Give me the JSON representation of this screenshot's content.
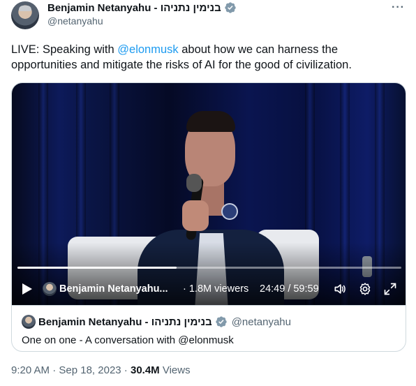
{
  "author": {
    "display_name": "Benjamin Netanyahu - בנימין נתניהו",
    "handle": "@netanyahu",
    "verified_color": "#829aab"
  },
  "tweet": {
    "text_before": "LIVE: Speaking with ",
    "mention": "@elonmusk",
    "text_after": " about how we can harness the opportunities and mitigate the risks of AI for the good of civilization."
  },
  "video": {
    "live_name": "Benjamin Netanyahu...",
    "viewers_prefix": "· ",
    "viewers": "1.8M viewers",
    "timecode": "24:49 / 59:59",
    "progress": 0.415,
    "icons": [
      "play-icon",
      "volume-icon",
      "settings-icon",
      "fullscreen-icon"
    ]
  },
  "quote": {
    "display_name": "Benjamin Netanyahu - בנימין נתניהו",
    "handle": "@netanyahu",
    "text": "One on one - A conversation with @elonmusk"
  },
  "meta": {
    "time": "9:20 AM",
    "sep1": " · ",
    "date": "Sep 18, 2023",
    "sep2": " · ",
    "views_count": "30.4M",
    "views_label": " Views"
  },
  "colors": {
    "accent": "#1d9bf0",
    "secondary_text": "#536471"
  }
}
